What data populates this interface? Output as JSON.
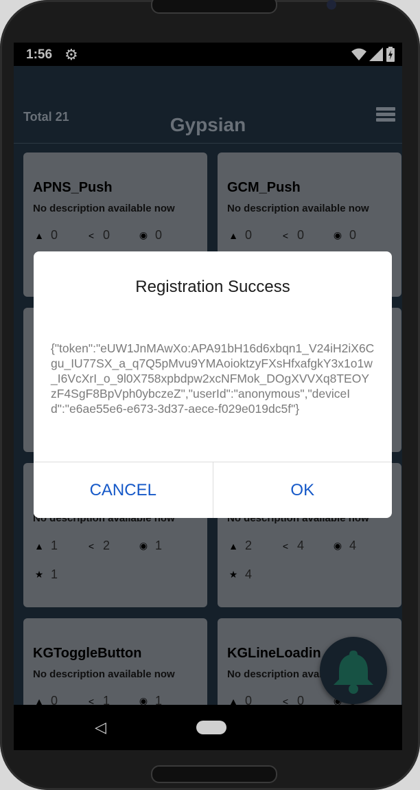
{
  "status_bar": {
    "time": "1:56"
  },
  "header": {
    "total": "Total 21",
    "title": "Gypsian"
  },
  "cards": [
    {
      "title": "APNS_Push",
      "description": "No description available now",
      "alerts": "0",
      "shares": "0",
      "views": "0"
    },
    {
      "title": "GCM_Push",
      "description": "No description available now",
      "alerts": "0",
      "shares": "0",
      "views": "0"
    },
    {
      "title": "",
      "description": "No description available now",
      "alerts": "1",
      "shares": "2",
      "views": "1",
      "stars": "1"
    },
    {
      "title": "",
      "description": "No description available now",
      "alerts": "2",
      "shares": "4",
      "views": "4",
      "stars": "4"
    },
    {
      "title": "KGToggleButton",
      "description": "No description available now",
      "alerts": "0",
      "shares": "1",
      "views": "1"
    },
    {
      "title": "KGLineLoadin",
      "description": "No description available now",
      "alerts": "0",
      "shares": "0",
      "views": "0"
    }
  ],
  "dialog": {
    "title": "Registration Success",
    "body": "{\"token\":\"eUW1JnMAwXo:APA91bH16d6xbqn1_V24iH2iX6Cgu_IU77SX_a_q7Q5pMvu9YMAoioktzyFXsHfxafgkY3x1o1w_I6VcXrI_o_9l0X758xpbdpw2xcNFMok_DOgXVVXq8TEOYzF4SgF8BpVph0ybczeZ\",\"userId\":\"anonymous\",\"deviceId\":\"e6ae55e6-e673-3d37-aece-f029e019dc5f\"}",
    "cancel_label": "CANCEL",
    "ok_label": "OK"
  },
  "icons": {
    "alert": "warning-icon",
    "share": "share-icon",
    "view": "eye-icon",
    "star": "star-icon",
    "fab": "bell-icon",
    "settings": "gear-icon"
  },
  "colors": {
    "app_bg": "#1d2b38",
    "card_bg": "#7a7f86",
    "dialog_button": "#1659c8",
    "bell": "#1f6e5b"
  }
}
